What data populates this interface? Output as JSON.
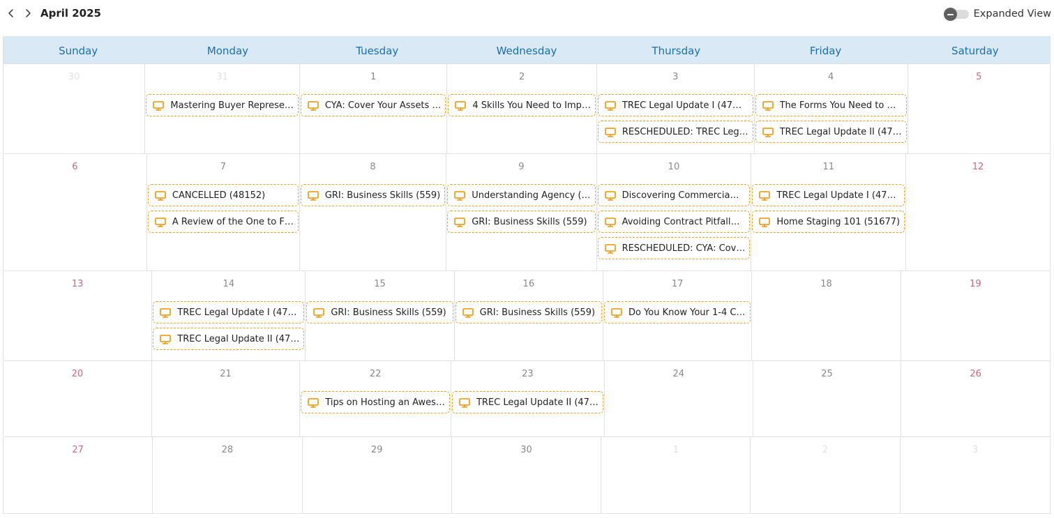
{
  "header": {
    "title": "April 2025",
    "prev_icon": "chevron-left-icon",
    "next_icon": "chevron-right-icon",
    "toggle_label": "Expanded View",
    "toggle_on": false
  },
  "colors": {
    "header_bg": "#d9e9f5",
    "weekday_text": "#1a6eb0",
    "event_border": "#f0a020",
    "event_icon": "#f0a020",
    "weekend_number": "#c8687a"
  },
  "event_icon": "monitor-icon",
  "weekdays": [
    "Sunday",
    "Monday",
    "Tuesday",
    "Wednesday",
    "Thursday",
    "Friday",
    "Saturday"
  ],
  "weeks": [
    {
      "days": [
        {
          "num": "30",
          "other": true,
          "events": []
        },
        {
          "num": "31",
          "other": true,
          "events": [
            "Mastering Buyer Represe…"
          ]
        },
        {
          "num": "1",
          "events": [
            "CYA: Cover Your Assets …"
          ]
        },
        {
          "num": "2",
          "events": [
            "4 Skills You Need to Imp…"
          ]
        },
        {
          "num": "3",
          "events": [
            "TREC Legal Update I (47…",
            "RESCHEDULED: TREC Leg…"
          ]
        },
        {
          "num": "4",
          "events": [
            "The Forms You Need to …",
            "TREC Legal Update II (47…"
          ]
        },
        {
          "num": "5",
          "events": []
        }
      ]
    },
    {
      "days": [
        {
          "num": "6",
          "events": []
        },
        {
          "num": "7",
          "events": [
            "CANCELLED (48152)",
            "A Review of the One to F…"
          ]
        },
        {
          "num": "8",
          "events": [
            "GRI: Business Skills (559)"
          ]
        },
        {
          "num": "9",
          "events": [
            "Understanding Agency (…",
            "GRI: Business Skills (559)"
          ]
        },
        {
          "num": "10",
          "events": [
            "Discovering Commercia…",
            "Avoiding Contract Pitfall…",
            "RESCHEDULED: CYA: Cov…"
          ]
        },
        {
          "num": "11",
          "events": [
            "TREC Legal Update I (47…",
            "Home Staging 101 (51677)"
          ]
        },
        {
          "num": "12",
          "events": []
        }
      ]
    },
    {
      "days": [
        {
          "num": "13",
          "events": []
        },
        {
          "num": "14",
          "events": [
            "TREC Legal Update I (47…",
            "TREC Legal Update II (47…"
          ]
        },
        {
          "num": "15",
          "events": [
            "GRI: Business Skills (559)"
          ]
        },
        {
          "num": "16",
          "events": [
            "GRI: Business Skills (559)"
          ]
        },
        {
          "num": "17",
          "events": [
            "Do You Know Your 1-4 C…"
          ]
        },
        {
          "num": "18",
          "events": []
        },
        {
          "num": "19",
          "events": []
        }
      ]
    },
    {
      "days": [
        {
          "num": "20",
          "events": []
        },
        {
          "num": "21",
          "events": []
        },
        {
          "num": "22",
          "events": [
            "Tips on Hosting an Awes…"
          ]
        },
        {
          "num": "23",
          "events": [
            "TREC Legal Update II (47…"
          ]
        },
        {
          "num": "24",
          "events": []
        },
        {
          "num": "25",
          "events": []
        },
        {
          "num": "26",
          "events": []
        }
      ]
    },
    {
      "days": [
        {
          "num": "27",
          "events": []
        },
        {
          "num": "28",
          "events": []
        },
        {
          "num": "29",
          "events": []
        },
        {
          "num": "30",
          "events": []
        },
        {
          "num": "1",
          "other": true,
          "events": []
        },
        {
          "num": "2",
          "other": true,
          "events": []
        },
        {
          "num": "3",
          "other": true,
          "events": []
        }
      ]
    }
  ]
}
